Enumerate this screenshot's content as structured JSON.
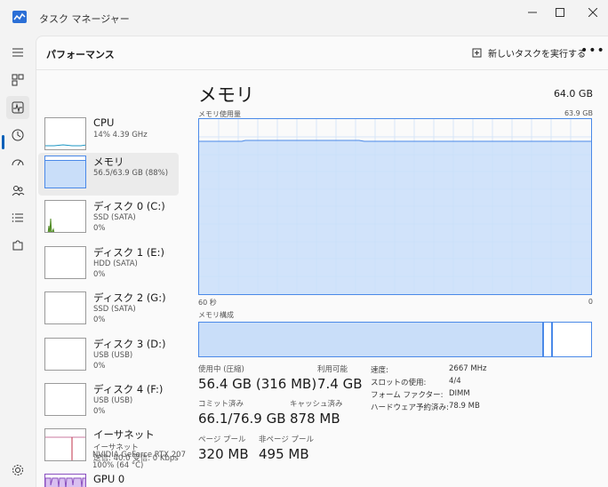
{
  "window": {
    "title": "タスク マネージャー"
  },
  "header": {
    "page_title": "パフォーマンス",
    "run_task_label": "新しいタスクを実行する"
  },
  "sidebar": {
    "items": [
      {
        "name": "CPU",
        "line1": "14%  4.39 GHz",
        "line2": ""
      },
      {
        "name": "メモリ",
        "line1": "56.5/63.9 GB (88%)",
        "line2": ""
      },
      {
        "name": "ディスク 0 (C:)",
        "line1": "SSD (SATA)",
        "line2": "0%"
      },
      {
        "name": "ディスク 1 (E:)",
        "line1": "HDD (SATA)",
        "line2": "0%"
      },
      {
        "name": "ディスク 2 (G:)",
        "line1": "SSD (SATA)",
        "line2": "0%"
      },
      {
        "name": "ディスク 3 (D:)",
        "line1": "USB (USB)",
        "line2": "0%"
      },
      {
        "name": "ディスク 4 (F:)",
        "line1": "USB (USB)",
        "line2": "0%"
      },
      {
        "name": "イーサネット",
        "line1": "イーサネット",
        "line2": "送信: 40.0  受信: 0 Kbps"
      },
      {
        "name": "GPU 0",
        "line1": "NVIDIA GeForce RTX 207",
        "line2": "100% (64 °C)"
      }
    ]
  },
  "main": {
    "title": "メモリ",
    "total": "64.0 GB",
    "usage_graph_label": "メモリ使用量",
    "usage_graph_max": "63.9 GB",
    "axis_left": "60 秒",
    "axis_right": "0",
    "composition_label": "メモリ構成",
    "usage_level": 0.88,
    "stats": {
      "in_use_label": "使用中 (圧縮)",
      "in_use_value": "56.4 GB (316 MB)",
      "available_label": "利用可能",
      "available_value": "7.4 GB",
      "committed_label": "コミット済み",
      "committed_value": "66.1/76.9 GB",
      "cached_label": "キャッシュ済み",
      "cached_value": "878 MB",
      "paged_pool_label": "ページ プール",
      "paged_pool_value": "320 MB",
      "nonpaged_pool_label": "非ページ プール",
      "nonpaged_pool_value": "495 MB"
    },
    "details": {
      "speed_label": "速度:",
      "speed_value": "2667 MHz",
      "slots_label": "スロットの使用:",
      "slots_value": "4/4",
      "form_factor_label": "フォーム ファクター:",
      "form_factor_value": "DIMM",
      "hw_reserved_label": "ハードウェア予約済み:",
      "hw_reserved_value": "78.9 MB"
    }
  },
  "colors": {
    "accent": "#005fb8",
    "memory_fill": "#c9def9",
    "memory_line": "#4a89e8"
  }
}
